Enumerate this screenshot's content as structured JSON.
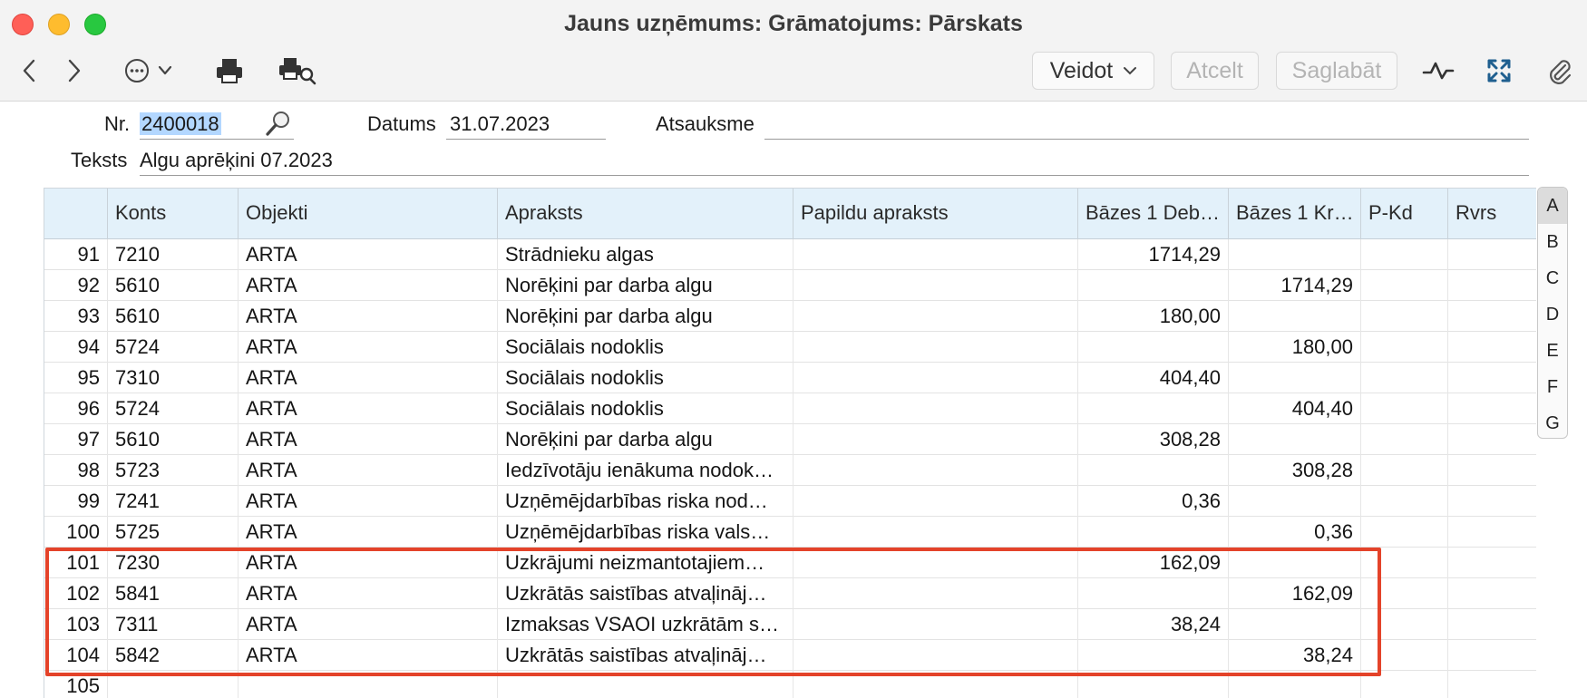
{
  "window": {
    "title": "Jauns uzņēmums: Grāmatojums: Pārskats"
  },
  "toolbar": {
    "create_label": "Veidot",
    "cancel_label": "Atcelt",
    "save_label": "Saglabāt"
  },
  "form": {
    "nr_label": "Nr.",
    "nr_value": "2400018",
    "date_label": "Datums",
    "date_value": "31.07.2023",
    "ref_label": "Atsauksme",
    "ref_value": "",
    "text_label": "Teksts",
    "text_value": "Algu aprēķini 07.2023"
  },
  "table": {
    "columns": [
      "",
      "Konts",
      "Objekti",
      "Apraksts",
      "Papildu apraksts",
      "Bāzes 1 Deb…",
      "Bāzes 1 Kr…",
      "P-Kd",
      "Rvrs"
    ],
    "rows": [
      {
        "n": "91",
        "konts": "7210",
        "obj": "ARTA",
        "apr": "Strādnieku algas",
        "pap": "",
        "deb": "1714,29",
        "kr": "",
        "pkd": "",
        "rvrs": ""
      },
      {
        "n": "92",
        "konts": "5610",
        "obj": "ARTA",
        "apr": "Norēķini par darba algu",
        "pap": "",
        "deb": "",
        "kr": "1714,29",
        "pkd": "",
        "rvrs": ""
      },
      {
        "n": "93",
        "konts": "5610",
        "obj": "ARTA",
        "apr": "Norēķini par darba algu",
        "pap": "",
        "deb": "180,00",
        "kr": "",
        "pkd": "",
        "rvrs": ""
      },
      {
        "n": "94",
        "konts": "5724",
        "obj": "ARTA",
        "apr": "Sociālais nodoklis",
        "pap": "",
        "deb": "",
        "kr": "180,00",
        "pkd": "",
        "rvrs": ""
      },
      {
        "n": "95",
        "konts": "7310",
        "obj": "ARTA",
        "apr": "Sociālais nodoklis",
        "pap": "",
        "deb": "404,40",
        "kr": "",
        "pkd": "",
        "rvrs": ""
      },
      {
        "n": "96",
        "konts": "5724",
        "obj": "ARTA",
        "apr": "Sociālais nodoklis",
        "pap": "",
        "deb": "",
        "kr": "404,40",
        "pkd": "",
        "rvrs": ""
      },
      {
        "n": "97",
        "konts": "5610",
        "obj": "ARTA",
        "apr": "Norēķini par darba algu",
        "pap": "",
        "deb": "308,28",
        "kr": "",
        "pkd": "",
        "rvrs": ""
      },
      {
        "n": "98",
        "konts": "5723",
        "obj": "ARTA",
        "apr": "Iedzīvotāju ienākuma nodok…",
        "pap": "",
        "deb": "",
        "kr": "308,28",
        "pkd": "",
        "rvrs": ""
      },
      {
        "n": "99",
        "konts": "7241",
        "obj": "ARTA",
        "apr": "Uzņēmējdarbības riska nod…",
        "pap": "",
        "deb": "0,36",
        "kr": "",
        "pkd": "",
        "rvrs": ""
      },
      {
        "n": "100",
        "konts": "5725",
        "obj": "ARTA",
        "apr": "Uzņēmējdarbības riska vals…",
        "pap": "",
        "deb": "",
        "kr": "0,36",
        "pkd": "",
        "rvrs": ""
      },
      {
        "n": "101",
        "konts": "7230",
        "obj": "ARTA",
        "apr": "Uzkrājumi neizmantotajiem…",
        "pap": "",
        "deb": "162,09",
        "kr": "",
        "pkd": "",
        "rvrs": ""
      },
      {
        "n": "102",
        "konts": "5841",
        "obj": "ARTA",
        "apr": "Uzkrātās saistības atvaļināj…",
        "pap": "",
        "deb": "",
        "kr": "162,09",
        "pkd": "",
        "rvrs": ""
      },
      {
        "n": "103",
        "konts": "7311",
        "obj": "ARTA",
        "apr": "Izmaksas VSAOI uzkrātām s…",
        "pap": "",
        "deb": "38,24",
        "kr": "",
        "pkd": "",
        "rvrs": ""
      },
      {
        "n": "104",
        "konts": "5842",
        "obj": "ARTA",
        "apr": "Uzkrātās saistības atvaļināj…",
        "pap": "",
        "deb": "",
        "kr": "38,24",
        "pkd": "",
        "rvrs": ""
      },
      {
        "n": "105",
        "konts": "",
        "obj": "",
        "apr": "",
        "pap": "",
        "deb": "",
        "kr": "",
        "pkd": "",
        "rvrs": ""
      }
    ]
  },
  "side_tabs": [
    "A",
    "B",
    "C",
    "D",
    "E",
    "F",
    "G"
  ],
  "colors": {
    "highlight": "#e4432a",
    "header_bg": "#e3f1fa",
    "selection": "#b3d7ff"
  }
}
